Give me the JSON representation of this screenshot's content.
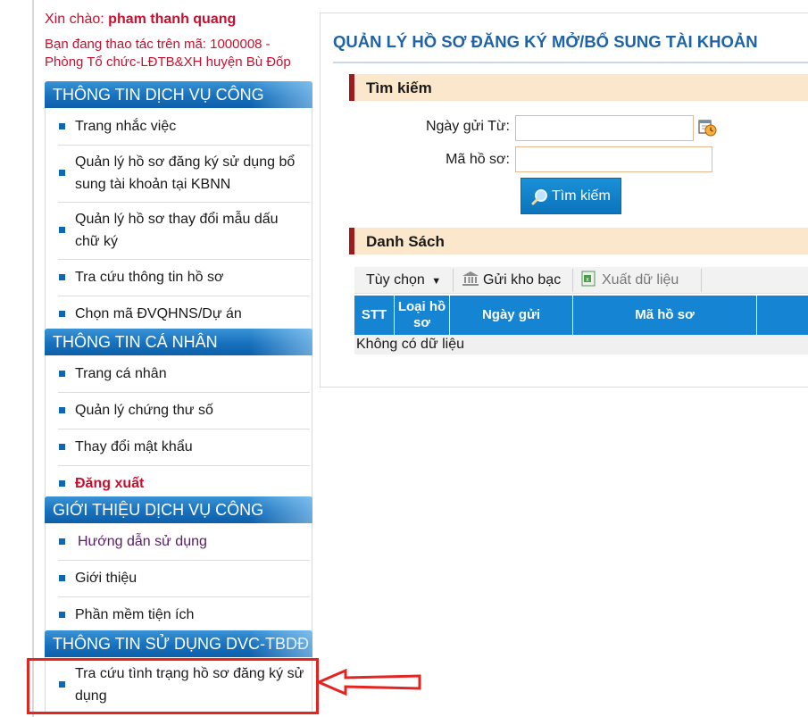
{
  "greeting": {
    "prefix": "Xin chào:",
    "username": "pham thanh quang"
  },
  "operation": {
    "text": "Bạn đang thao tác trên mã: 1000008 - Phòng Tổ chức-LĐTB&XH huyện Bù Đốp"
  },
  "sidebar": {
    "sections": [
      {
        "title": "THÔNG TIN DỊCH VỤ CÔNG",
        "items": [
          "Trang nhắc việc",
          "Quản lý hồ sơ đăng ký sử dụng bổ sung tài khoản tại KBNN",
          "Quản lý hồ sơ thay đổi mẫu dấu chữ ký",
          "Tra cứu thông tin hồ sơ",
          "Chọn mã ĐVQHNS/Dự án"
        ]
      },
      {
        "title": "THÔNG TIN CÁ NHÂN",
        "items": [
          "Trang cá nhân",
          "Quản lý chứng thư số",
          "Thay đổi mật khẩu",
          "Đăng xuất"
        ]
      },
      {
        "title": "GIỚI THIỆU DỊCH VỤ CÔNG",
        "items": [
          "Hướng dẫn sử dụng",
          "Giới thiệu",
          "Phần mềm tiện ích"
        ]
      },
      {
        "title": "THÔNG TIN SỬ DỤNG DVC-TBDĐ",
        "items": [
          "Tra cứu tình trạng hồ sơ đăng ký sử dụng"
        ]
      }
    ]
  },
  "main": {
    "title": "QUẢN LÝ HỒ SƠ ĐĂNG KÝ MỞ/BỔ SUNG TÀI KHOẢN",
    "search_section": "Tìm kiếm",
    "date_label": "Ngày gửi Từ:",
    "date_value": "",
    "code_label": "Mã hồ sơ:",
    "code_value": "",
    "search_button": "Tìm kiếm",
    "list_section": "Danh Sách",
    "toolbar": {
      "options": "Tùy chọn",
      "send": "Gửi kho bạc",
      "export": "Xuất dữ liệu"
    },
    "columns": [
      "STT",
      "Loại hồ sơ",
      "Ngày gửi",
      "Mã hồ sơ",
      ""
    ],
    "empty_text": "Không có dữ liệu"
  },
  "colors": {
    "accent_blue": "#1585d3",
    "brand_red": "#c8102e",
    "highlight_red": "#e52421",
    "section_bg": "#fbe8cc"
  }
}
